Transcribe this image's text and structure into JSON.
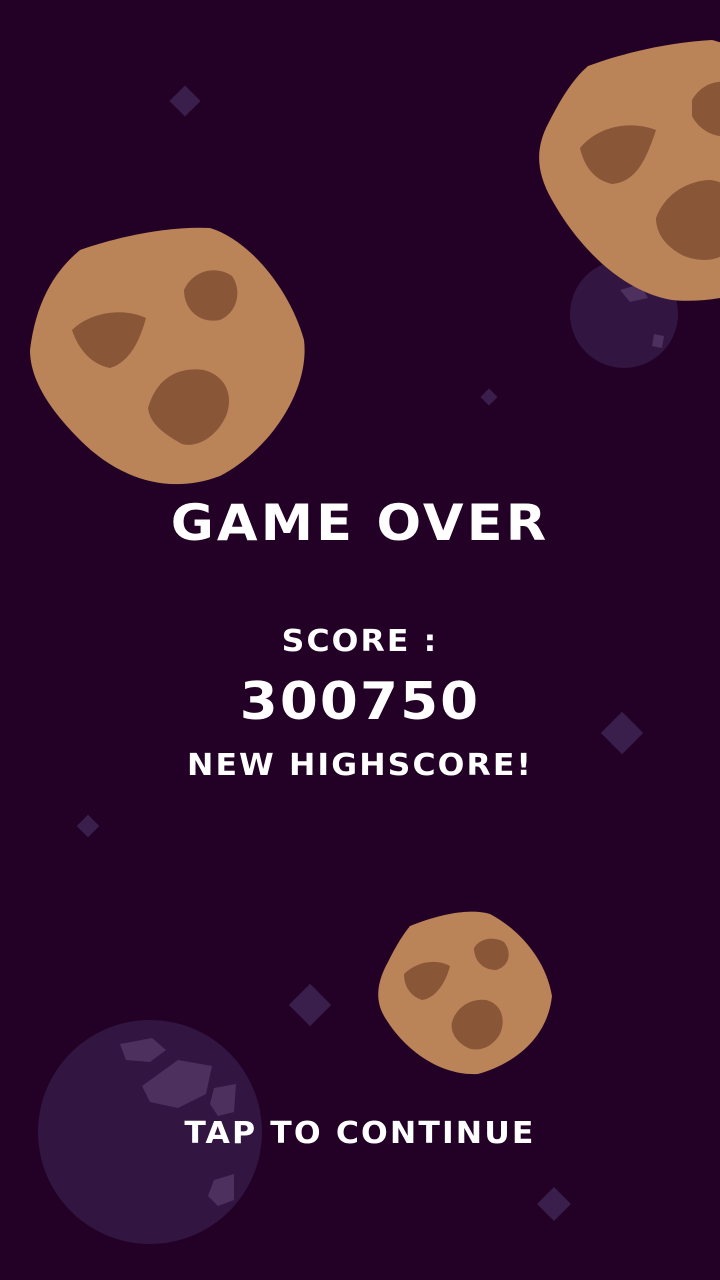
{
  "game_over": {
    "title": "GAME OVER",
    "score_label": "SCORE :",
    "score_value": "300750",
    "new_highscore": "NEW HIGHSCORE!",
    "continue_prompt": "TAP TO CONTINUE"
  },
  "colors": {
    "background": "#230026",
    "asteroid": "#bb8358",
    "asteroid_crater": "#8a5638",
    "planet": "#321540",
    "planet_crater": "#4e305f",
    "star": "#3a1e4c",
    "text": "#ffffff"
  }
}
